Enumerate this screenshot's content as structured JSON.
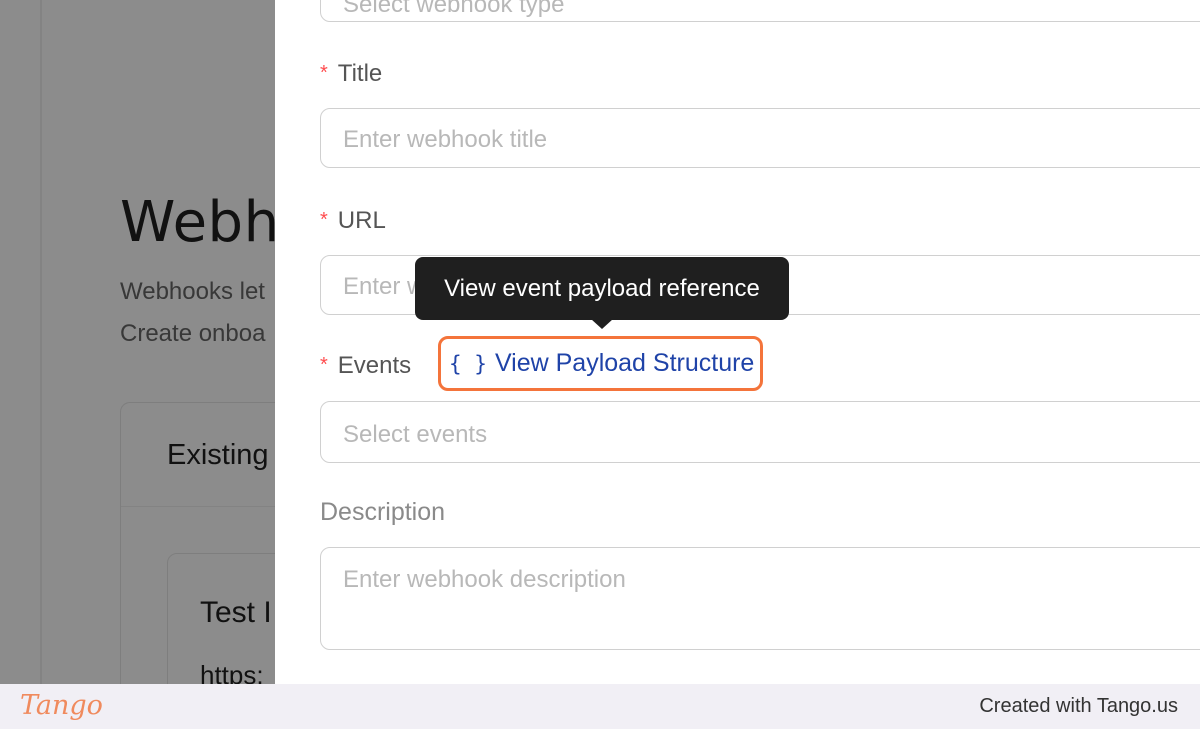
{
  "background_page": {
    "title": "Webho",
    "description_line1": "Webhooks let",
    "description_line2": "Create onboa",
    "card_title": "Existing",
    "inner_card_title": "Test I",
    "inner_card_url": "https:"
  },
  "drawer": {
    "type_field": {
      "placeholder": "Select webhook type"
    },
    "title_field": {
      "label": "Title",
      "required_mark": "*",
      "placeholder": "Enter webhook title"
    },
    "url_field": {
      "label": "URL",
      "required_mark": "*",
      "placeholder": "Enter webhook URL"
    },
    "events_field": {
      "label": "Events",
      "required_mark": "*",
      "link_icon": "{ }",
      "link_label": "View Payload Structure",
      "placeholder": "Select events"
    },
    "description_field": {
      "label": "Description",
      "placeholder": "Enter webhook description"
    },
    "tooltip": "View event payload reference"
  },
  "footer": {
    "logo": "Tango",
    "credit": "Created with Tango.us"
  },
  "colors": {
    "highlight": "#f4743b",
    "link": "#1f43a8",
    "required": "#ff4d4f",
    "tooltip_bg": "#1f1f1f",
    "footer_bg": "#f1eff5"
  }
}
